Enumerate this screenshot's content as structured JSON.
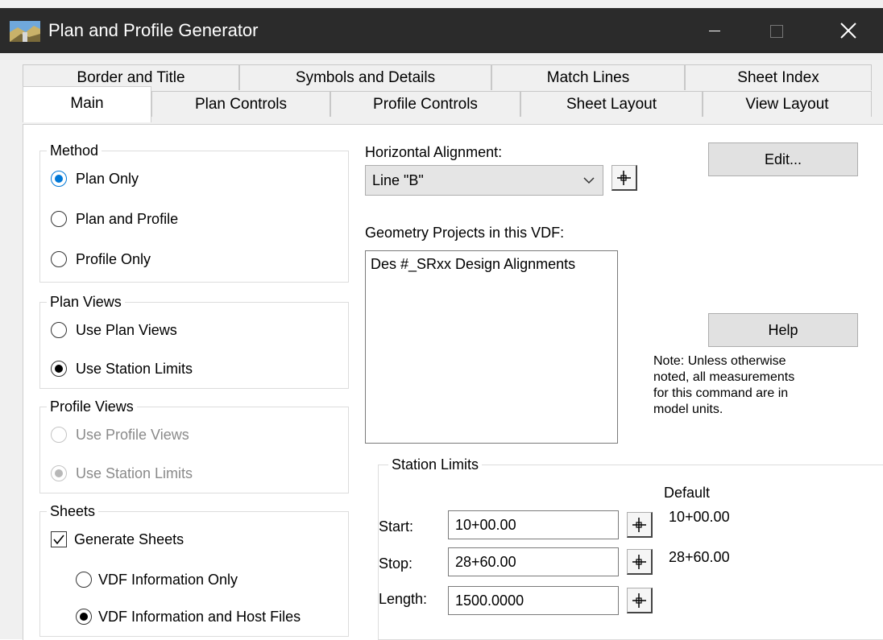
{
  "window": {
    "title": "Plan and Profile Generator"
  },
  "tabs_row1": [
    "Border and Title",
    "Symbols and Details",
    "Match Lines",
    "Sheet Index"
  ],
  "tabs_row2": [
    "Main",
    "Plan Controls",
    "Profile Controls",
    "Sheet Layout",
    "View Layout"
  ],
  "active_tab": "Main",
  "method": {
    "legend": "Method",
    "options": [
      "Plan Only",
      "Plan and Profile",
      "Profile Only"
    ],
    "selected": "Plan Only"
  },
  "plan_views": {
    "legend": "Plan Views",
    "options": [
      "Use Plan Views",
      "Use Station Limits"
    ],
    "selected": "Use Station Limits"
  },
  "profile_views": {
    "legend": "Profile Views",
    "options": [
      "Use Profile Views",
      "Use Station Limits"
    ],
    "selected": "Use Station Limits",
    "disabled": true
  },
  "sheets": {
    "legend": "Sheets",
    "generate_label": "Generate Sheets",
    "generate_checked": true,
    "options": [
      "VDF Information Only",
      "VDF Information and Host Files"
    ],
    "selected": "VDF Information and Host Files"
  },
  "horizontal_alignment": {
    "label": "Horizontal Alignment:",
    "value": "Line \"B\""
  },
  "geometry_projects": {
    "label": "Geometry Projects in this VDF:",
    "items": [
      "Des #_SRxx Design Alignments"
    ]
  },
  "buttons": {
    "edit": "Edit...",
    "help": "Help"
  },
  "note": [
    "Note:  Unless otherwise",
    "noted, all measurements",
    "for this command are in",
    "model units."
  ],
  "station_limits": {
    "legend": "Station Limits",
    "default_header": "Default",
    "start_label": "Start:",
    "start_value": "10+00.00",
    "start_default": "10+00.00",
    "stop_label": "Stop:",
    "stop_value": "28+60.00",
    "stop_default": "28+60.00",
    "length_label": "Length:",
    "length_value": "1500.0000"
  },
  "icons": {
    "app": "plan-profile-app-icon",
    "pick": "crosshair-pick-icon",
    "dropdown": "chevron-down-icon",
    "close": "close-icon",
    "minimize": "minimize-icon",
    "maximize": "maximize-icon"
  },
  "colors": {
    "titlebar": "#2b2b2b",
    "selection_blue": "#0078d7"
  }
}
